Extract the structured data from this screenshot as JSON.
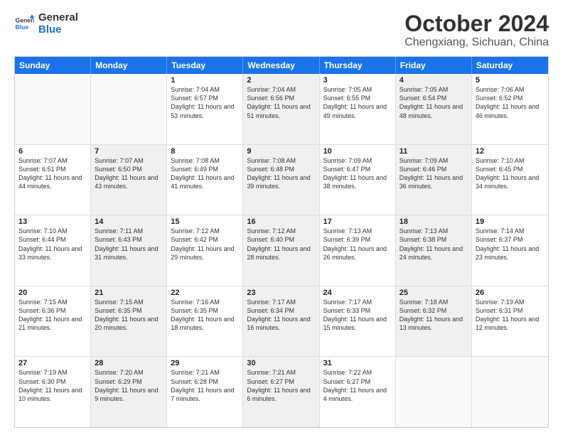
{
  "logo": {
    "line1": "General",
    "line2": "Blue"
  },
  "title": "October 2024",
  "subtitle": "Chengxiang, Sichuan, China",
  "days": [
    "Sunday",
    "Monday",
    "Tuesday",
    "Wednesday",
    "Thursday",
    "Friday",
    "Saturday"
  ],
  "weeks": [
    [
      {
        "day": "",
        "sunrise": "",
        "sunset": "",
        "daylight": "",
        "shaded": false,
        "empty": true
      },
      {
        "day": "",
        "sunrise": "",
        "sunset": "",
        "daylight": "",
        "shaded": false,
        "empty": true
      },
      {
        "day": "1",
        "sunrise": "Sunrise: 7:04 AM",
        "sunset": "Sunset: 6:57 PM",
        "daylight": "Daylight: 11 hours and 53 minutes.",
        "shaded": false,
        "empty": false
      },
      {
        "day": "2",
        "sunrise": "Sunrise: 7:04 AM",
        "sunset": "Sunset: 6:56 PM",
        "daylight": "Daylight: 11 hours and 51 minutes.",
        "shaded": true,
        "empty": false
      },
      {
        "day": "3",
        "sunrise": "Sunrise: 7:05 AM",
        "sunset": "Sunset: 6:55 PM",
        "daylight": "Daylight: 11 hours and 49 minutes.",
        "shaded": false,
        "empty": false
      },
      {
        "day": "4",
        "sunrise": "Sunrise: 7:05 AM",
        "sunset": "Sunset: 6:54 PM",
        "daylight": "Daylight: 11 hours and 48 minutes.",
        "shaded": true,
        "empty": false
      },
      {
        "day": "5",
        "sunrise": "Sunrise: 7:06 AM",
        "sunset": "Sunset: 6:52 PM",
        "daylight": "Daylight: 11 hours and 46 minutes.",
        "shaded": false,
        "empty": false
      }
    ],
    [
      {
        "day": "6",
        "sunrise": "Sunrise: 7:07 AM",
        "sunset": "Sunset: 6:51 PM",
        "daylight": "Daylight: 11 hours and 44 minutes.",
        "shaded": false,
        "empty": false
      },
      {
        "day": "7",
        "sunrise": "Sunrise: 7:07 AM",
        "sunset": "Sunset: 6:50 PM",
        "daylight": "Daylight: 11 hours and 43 minutes.",
        "shaded": true,
        "empty": false
      },
      {
        "day": "8",
        "sunrise": "Sunrise: 7:08 AM",
        "sunset": "Sunset: 6:49 PM",
        "daylight": "Daylight: 11 hours and 41 minutes.",
        "shaded": false,
        "empty": false
      },
      {
        "day": "9",
        "sunrise": "Sunrise: 7:08 AM",
        "sunset": "Sunset: 6:48 PM",
        "daylight": "Daylight: 11 hours and 39 minutes.",
        "shaded": true,
        "empty": false
      },
      {
        "day": "10",
        "sunrise": "Sunrise: 7:09 AM",
        "sunset": "Sunset: 6:47 PM",
        "daylight": "Daylight: 11 hours and 38 minutes.",
        "shaded": false,
        "empty": false
      },
      {
        "day": "11",
        "sunrise": "Sunrise: 7:09 AM",
        "sunset": "Sunset: 6:46 PM",
        "daylight": "Daylight: 11 hours and 36 minutes.",
        "shaded": true,
        "empty": false
      },
      {
        "day": "12",
        "sunrise": "Sunrise: 7:10 AM",
        "sunset": "Sunset: 6:45 PM",
        "daylight": "Daylight: 11 hours and 34 minutes.",
        "shaded": false,
        "empty": false
      }
    ],
    [
      {
        "day": "13",
        "sunrise": "Sunrise: 7:10 AM",
        "sunset": "Sunset: 6:44 PM",
        "daylight": "Daylight: 11 hours and 33 minutes.",
        "shaded": false,
        "empty": false
      },
      {
        "day": "14",
        "sunrise": "Sunrise: 7:11 AM",
        "sunset": "Sunset: 6:43 PM",
        "daylight": "Daylight: 11 hours and 31 minutes.",
        "shaded": true,
        "empty": false
      },
      {
        "day": "15",
        "sunrise": "Sunrise: 7:12 AM",
        "sunset": "Sunset: 6:42 PM",
        "daylight": "Daylight: 11 hours and 29 minutes.",
        "shaded": false,
        "empty": false
      },
      {
        "day": "16",
        "sunrise": "Sunrise: 7:12 AM",
        "sunset": "Sunset: 6:40 PM",
        "daylight": "Daylight: 11 hours and 28 minutes.",
        "shaded": true,
        "empty": false
      },
      {
        "day": "17",
        "sunrise": "Sunrise: 7:13 AM",
        "sunset": "Sunset: 6:39 PM",
        "daylight": "Daylight: 11 hours and 26 minutes.",
        "shaded": false,
        "empty": false
      },
      {
        "day": "18",
        "sunrise": "Sunrise: 7:13 AM",
        "sunset": "Sunset: 6:38 PM",
        "daylight": "Daylight: 11 hours and 24 minutes.",
        "shaded": true,
        "empty": false
      },
      {
        "day": "19",
        "sunrise": "Sunrise: 7:14 AM",
        "sunset": "Sunset: 6:37 PM",
        "daylight": "Daylight: 11 hours and 23 minutes.",
        "shaded": false,
        "empty": false
      }
    ],
    [
      {
        "day": "20",
        "sunrise": "Sunrise: 7:15 AM",
        "sunset": "Sunset: 6:36 PM",
        "daylight": "Daylight: 11 hours and 21 minutes.",
        "shaded": false,
        "empty": false
      },
      {
        "day": "21",
        "sunrise": "Sunrise: 7:15 AM",
        "sunset": "Sunset: 6:35 PM",
        "daylight": "Daylight: 11 hours and 20 minutes.",
        "shaded": true,
        "empty": false
      },
      {
        "day": "22",
        "sunrise": "Sunrise: 7:16 AM",
        "sunset": "Sunset: 6:35 PM",
        "daylight": "Daylight: 11 hours and 18 minutes.",
        "shaded": false,
        "empty": false
      },
      {
        "day": "23",
        "sunrise": "Sunrise: 7:17 AM",
        "sunset": "Sunset: 6:34 PM",
        "daylight": "Daylight: 11 hours and 16 minutes.",
        "shaded": true,
        "empty": false
      },
      {
        "day": "24",
        "sunrise": "Sunrise: 7:17 AM",
        "sunset": "Sunset: 6:33 PM",
        "daylight": "Daylight: 11 hours and 15 minutes.",
        "shaded": false,
        "empty": false
      },
      {
        "day": "25",
        "sunrise": "Sunrise: 7:18 AM",
        "sunset": "Sunset: 6:32 PM",
        "daylight": "Daylight: 11 hours and 13 minutes.",
        "shaded": true,
        "empty": false
      },
      {
        "day": "26",
        "sunrise": "Sunrise: 7:19 AM",
        "sunset": "Sunset: 6:31 PM",
        "daylight": "Daylight: 11 hours and 12 minutes.",
        "shaded": false,
        "empty": false
      }
    ],
    [
      {
        "day": "27",
        "sunrise": "Sunrise: 7:19 AM",
        "sunset": "Sunset: 6:30 PM",
        "daylight": "Daylight: 11 hours and 10 minutes.",
        "shaded": false,
        "empty": false
      },
      {
        "day": "28",
        "sunrise": "Sunrise: 7:20 AM",
        "sunset": "Sunset: 6:29 PM",
        "daylight": "Daylight: 11 hours and 9 minutes.",
        "shaded": true,
        "empty": false
      },
      {
        "day": "29",
        "sunrise": "Sunrise: 7:21 AM",
        "sunset": "Sunset: 6:28 PM",
        "daylight": "Daylight: 11 hours and 7 minutes.",
        "shaded": false,
        "empty": false
      },
      {
        "day": "30",
        "sunrise": "Sunrise: 7:21 AM",
        "sunset": "Sunset: 6:27 PM",
        "daylight": "Daylight: 11 hours and 6 minutes.",
        "shaded": true,
        "empty": false
      },
      {
        "day": "31",
        "sunrise": "Sunrise: 7:22 AM",
        "sunset": "Sunset: 6:27 PM",
        "daylight": "Daylight: 11 hours and 4 minutes.",
        "shaded": false,
        "empty": false
      },
      {
        "day": "",
        "sunrise": "",
        "sunset": "",
        "daylight": "",
        "shaded": false,
        "empty": true
      },
      {
        "day": "",
        "sunrise": "",
        "sunset": "",
        "daylight": "",
        "shaded": false,
        "empty": true
      }
    ]
  ]
}
